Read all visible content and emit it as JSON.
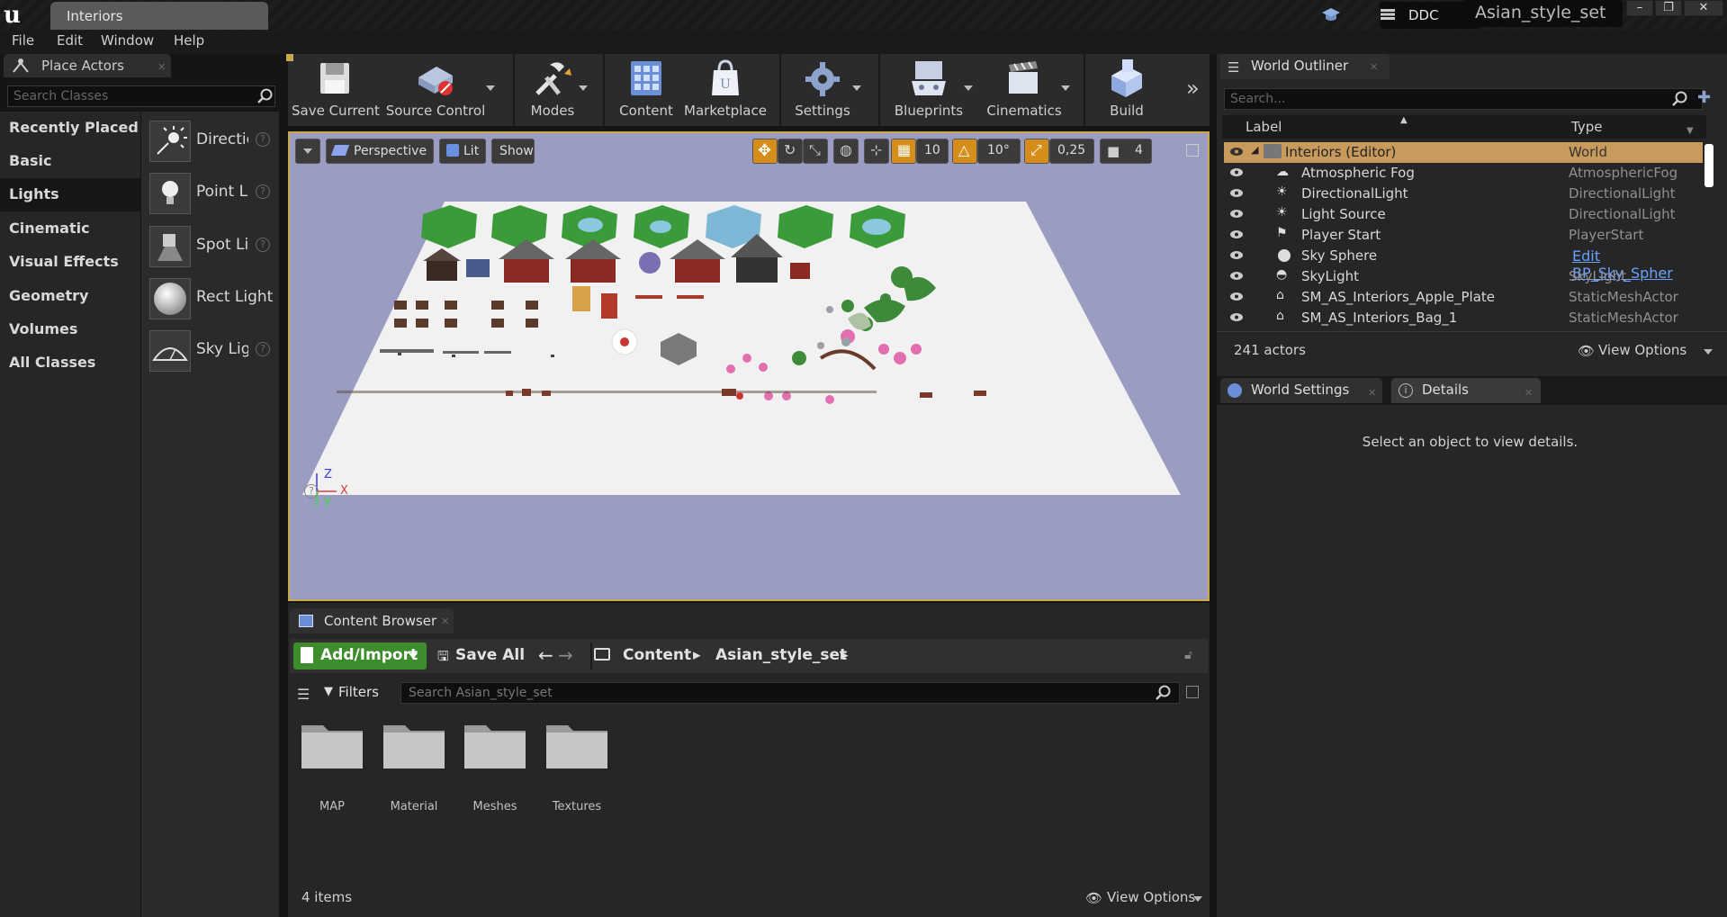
{
  "window": {
    "tab_title": "Interiors",
    "ddc_label": "DDC",
    "project_name": "Asian_style_set",
    "controls": [
      "–",
      "❐",
      "✕"
    ]
  },
  "menu": [
    "File",
    "Edit",
    "Window",
    "Help"
  ],
  "place_actors": {
    "tab": "Place Actors",
    "search_placeholder": "Search Classes",
    "categories": [
      "Recently Placed",
      "Basic",
      "Lights",
      "Cinematic",
      "Visual Effects",
      "Geometry",
      "Volumes",
      "All Classes"
    ],
    "active_category": "Lights",
    "actors": [
      {
        "label": "Directic",
        "icon": "directional-light-icon"
      },
      {
        "label": "Point Li",
        "icon": "point-light-icon"
      },
      {
        "label": "Spot Lic",
        "icon": "spot-light-icon"
      },
      {
        "label": "Rect Light",
        "icon": "rect-light-icon"
      },
      {
        "label": "Sky Lig",
        "icon": "sky-light-icon"
      }
    ]
  },
  "toolbar": [
    {
      "label": "Save Current",
      "icon": "save-icon"
    },
    {
      "label": "Source Control",
      "icon": "source-control-icon"
    },
    {
      "label": "Modes",
      "icon": "modes-icon"
    },
    {
      "label": "Content",
      "icon": "content-icon"
    },
    {
      "label": "Marketplace",
      "icon": "marketplace-icon"
    },
    {
      "label": "Settings",
      "icon": "settings-icon"
    },
    {
      "label": "Blueprints",
      "icon": "blueprints-icon"
    },
    {
      "label": "Cinematics",
      "icon": "cinematics-icon"
    },
    {
      "label": "Build",
      "icon": "build-icon"
    }
  ],
  "viewport": {
    "view_mode": "Perspective",
    "lighting": "Lit",
    "show": "Show",
    "grid_snap": "10",
    "rotation_snap": "10°",
    "scale_snap": "0,25",
    "camera_speed": "4",
    "axis_labels": [
      "Z",
      "X",
      "Y"
    ]
  },
  "content_browser": {
    "tab": "Content Browser",
    "add_import": "Add/Import",
    "save_all": "Save All",
    "breadcrumbs": [
      "Content",
      "Asian_style_set"
    ],
    "filters": "Filters",
    "search_placeholder": "Search Asian_style_set",
    "folders": [
      "MAP",
      "Material",
      "Meshes",
      "Textures"
    ],
    "item_count": "4 items",
    "view_options": "View Options"
  },
  "world_outliner": {
    "tab": "World Outliner",
    "search_placeholder": "Search...",
    "col_label": "Label",
    "col_type": "Type",
    "rows": [
      {
        "label": "Interiors (Editor)",
        "type": "World",
        "selected": true
      },
      {
        "label": "Atmospheric Fog",
        "type": "AtmosphericFog"
      },
      {
        "label": "DirectionalLight",
        "type": "DirectionalLight"
      },
      {
        "label": "Light Source",
        "type": "DirectionalLight"
      },
      {
        "label": "Player Start",
        "type": "PlayerStart"
      },
      {
        "label": "Sky Sphere",
        "type": "Edit BP_Sky_Spher",
        "link": true
      },
      {
        "label": "SkyLight",
        "type": "SkyLight"
      },
      {
        "label": "SM_AS_Interiors_Apple_Plate",
        "type": "StaticMeshActor"
      },
      {
        "label": "SM_AS_Interiors_Bag_1",
        "type": "StaticMeshActor"
      }
    ],
    "actor_count": "241 actors",
    "view_options": "View Options"
  },
  "details": {
    "tabs": [
      "World Settings",
      "Details"
    ],
    "hint": "Select an object to view details."
  },
  "colors": {
    "accent_orange": "#caa94a",
    "add_green": "#3d8d2c",
    "selection": "#c89a5c",
    "viewport_bg": "#9a9cc1"
  }
}
